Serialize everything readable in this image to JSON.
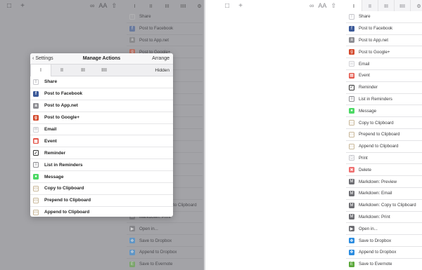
{
  "left_panel": {
    "toolbar": {
      "doc_icon": "document-icon",
      "add_icon": "plus-icon",
      "link_icon": "link-icon",
      "font_label": "AA",
      "share_icon": "share-icon",
      "gear_icon": "gear-icon"
    },
    "background_list": [
      {
        "label": "Share",
        "icon": "share-icon",
        "color": "#bdbdbd"
      },
      {
        "label": "Post to Facebook",
        "icon": "facebook-icon",
        "color": "#3b5998"
      },
      {
        "label": "Post to App.net",
        "icon": "appnet-icon",
        "color": "#777777"
      },
      {
        "label": "Post to Google+",
        "icon": "googleplus-icon",
        "color": "#d3492c"
      },
      {
        "label": "",
        "icon": "",
        "color": ""
      },
      {
        "label": "",
        "icon": "",
        "color": ""
      },
      {
        "label": "",
        "icon": "",
        "color": ""
      },
      {
        "label": "",
        "icon": "",
        "color": ""
      },
      {
        "label": "",
        "icon": "",
        "color": ""
      },
      {
        "label": "",
        "icon": "",
        "color": ""
      },
      {
        "label": "oard",
        "icon": "",
        "color": ""
      },
      {
        "label": "oard",
        "icon": "",
        "color": ""
      },
      {
        "label": "board",
        "icon": "",
        "color": ""
      },
      {
        "label": "",
        "icon": "",
        "color": ""
      },
      {
        "label": "iew",
        "icon": "",
        "color": ""
      },
      {
        "label": "il",
        "icon": "",
        "color": ""
      },
      {
        "label": "Markdown: Copy to Clipboard",
        "icon": "markdown-icon",
        "color": "#6d6d72"
      },
      {
        "label": "Markdown: Print",
        "icon": "markdown-icon",
        "color": "#6d6d72"
      },
      {
        "label": "Open in...",
        "icon": "play-icon",
        "color": "#6d6d72"
      },
      {
        "label": "Save to Dropbox",
        "icon": "dropbox-icon",
        "color": "#2b8ce0"
      },
      {
        "label": "Append to Dropbox",
        "icon": "dropbox-icon",
        "color": "#2b8ce0"
      },
      {
        "label": "Save to Evernote",
        "icon": "evernote-icon",
        "color": "#5aa83a"
      }
    ],
    "modal": {
      "back_label": "Settings",
      "title": "Manage Actions",
      "arrange_label": "Arrange",
      "hidden_label": "Hidden",
      "tabs": [
        "I",
        "II",
        "III",
        "IIII"
      ],
      "items": [
        {
          "label": "Share",
          "icon": "share-icon",
          "color": "#c7c7cc"
        },
        {
          "label": "Post to Facebook",
          "icon": "facebook-icon",
          "color": "#3b5998"
        },
        {
          "label": "Post to App.net",
          "icon": "appnet-icon",
          "color": "#8e8e93"
        },
        {
          "label": "Post to Google+",
          "icon": "googleplus-icon",
          "color": "#d3492c"
        },
        {
          "label": "Email",
          "icon": "mail-icon",
          "color": "#d0d0d4"
        },
        {
          "label": "Event",
          "icon": "calendar-icon",
          "color": "#e4564a"
        },
        {
          "label": "Reminder",
          "icon": "checkmark-icon",
          "color": "#333333"
        },
        {
          "label": "List in Reminders",
          "icon": "list-icon",
          "color": "#8e8e93"
        },
        {
          "label": "Message",
          "icon": "message-icon",
          "color": "#4cd964"
        },
        {
          "label": "Copy to Clipboard",
          "icon": "clipboard-icon",
          "color": "#c9b89a"
        },
        {
          "label": "Prepend to Clipboard",
          "icon": "clipboard-icon",
          "color": "#c9b89a"
        },
        {
          "label": "Append to Clipboard",
          "icon": "clipboard-icon",
          "color": "#c9b89a"
        }
      ]
    }
  },
  "right_panel": {
    "toolbar": {
      "doc_icon": "document-icon",
      "add_icon": "plus-icon",
      "link_icon": "link-icon",
      "font_label": "AA",
      "share_icon": "share-icon",
      "gear_icon": "gear-icon"
    },
    "tabs": [
      "I",
      "II",
      "III",
      "IIII"
    ],
    "items": [
      {
        "label": "Share",
        "icon": "share-icon",
        "color": "#c7c7cc"
      },
      {
        "label": "Post to Facebook",
        "icon": "facebook-icon",
        "color": "#3b5998"
      },
      {
        "label": "Post to App.net",
        "icon": "appnet-icon",
        "color": "#8e8e93"
      },
      {
        "label": "Post to Google+",
        "icon": "googleplus-icon",
        "color": "#d3492c"
      },
      {
        "label": "Email",
        "icon": "mail-icon",
        "color": "#d0d0d4"
      },
      {
        "label": "Event",
        "icon": "calendar-icon",
        "color": "#e4564a"
      },
      {
        "label": "Reminder",
        "icon": "checkmark-icon",
        "color": "#333333"
      },
      {
        "label": "List in Reminders",
        "icon": "list-icon",
        "color": "#8e8e93"
      },
      {
        "label": "Message",
        "icon": "message-icon",
        "color": "#4cd964"
      },
      {
        "label": "Copy to Clipboard",
        "icon": "clipboard-icon",
        "color": "#c9b89a"
      },
      {
        "label": "Prepend to Clipboard",
        "icon": "clipboard-icon",
        "color": "#c9b89a"
      },
      {
        "label": "Append to Clipboard",
        "icon": "clipboard-icon",
        "color": "#c9b89a"
      },
      {
        "label": "Print",
        "icon": "print-icon",
        "color": "#c7c7cc"
      },
      {
        "label": "Delete",
        "icon": "delete-icon",
        "color": "#ef6f6f"
      },
      {
        "label": "Markdown: Preview",
        "icon": "markdown-icon",
        "color": "#6d6d72"
      },
      {
        "label": "Markdown: Email",
        "icon": "markdown-icon",
        "color": "#6d6d72"
      },
      {
        "label": "Markdown: Copy to Clipboard",
        "icon": "markdown-icon",
        "color": "#6d6d72"
      },
      {
        "label": "Markdown: Print",
        "icon": "markdown-icon",
        "color": "#6d6d72"
      },
      {
        "label": "Open in...",
        "icon": "play-icon",
        "color": "#6d6d72"
      },
      {
        "label": "Save to Dropbox",
        "icon": "dropbox-icon",
        "color": "#2b8ce0"
      },
      {
        "label": "Append to Dropbox",
        "icon": "dropbox-icon",
        "color": "#2b8ce0"
      },
      {
        "label": "Save to Evernote",
        "icon": "evernote-icon",
        "color": "#5aa83a"
      }
    ]
  }
}
